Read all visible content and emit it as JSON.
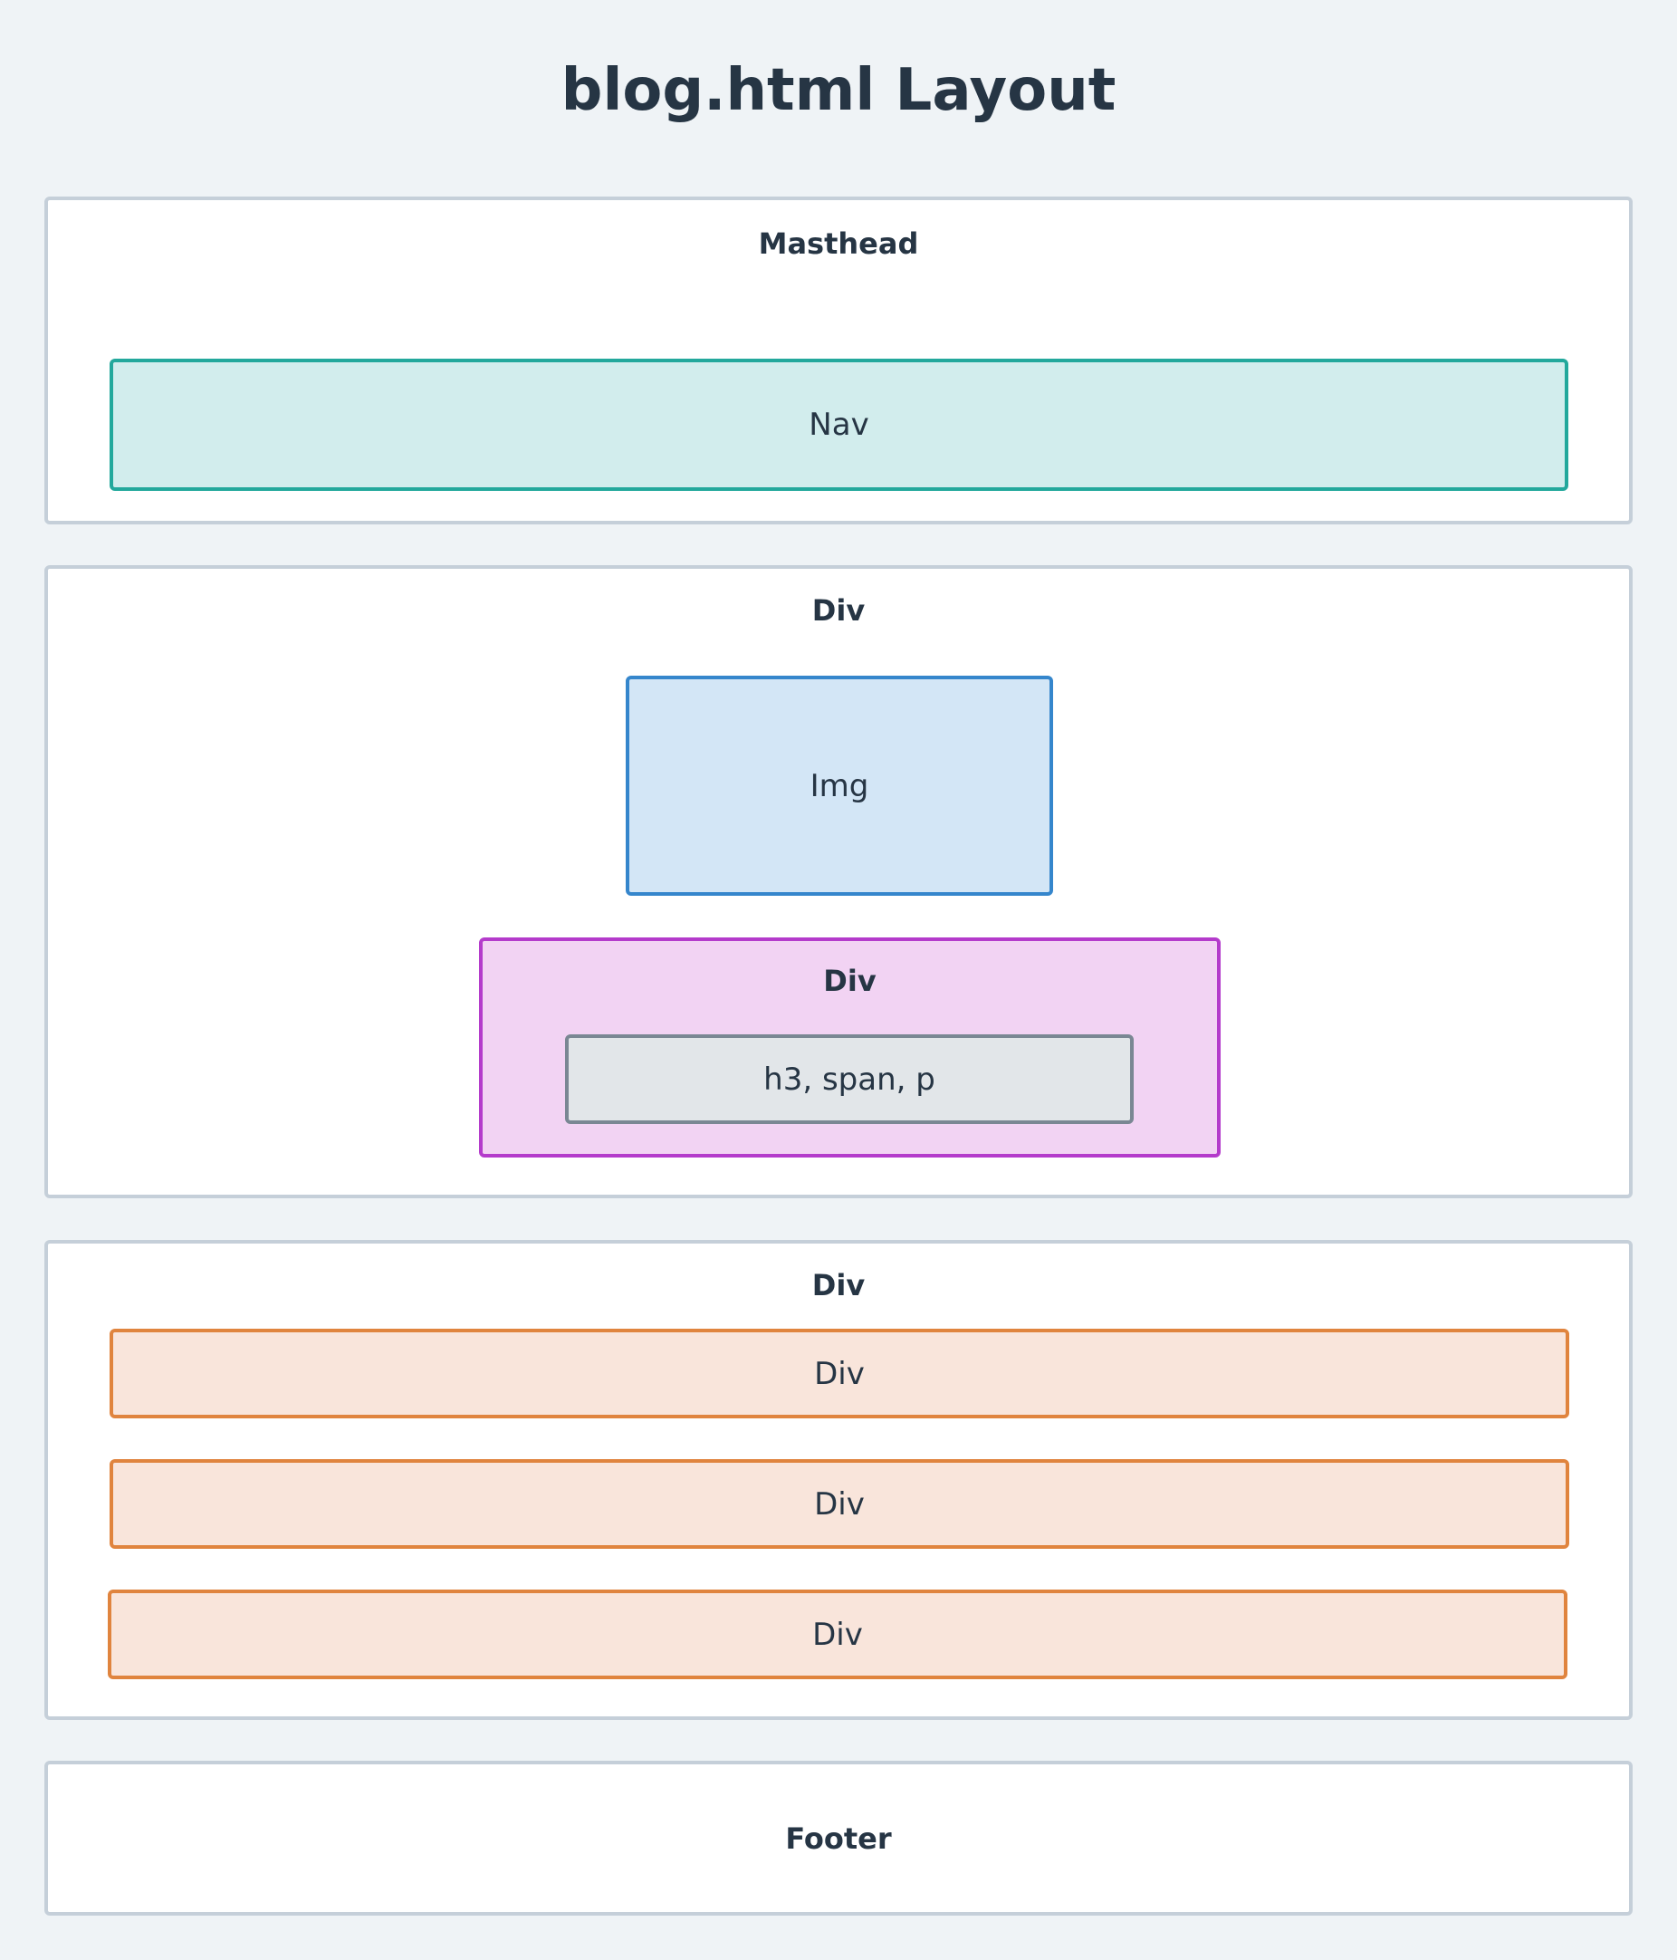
{
  "title": "blog.html Layout",
  "masthead": {
    "label": "Masthead",
    "nav": "Nav"
  },
  "hero": {
    "label": "Div",
    "img": "Img",
    "inner": {
      "label": "Div",
      "content": "h3, span, p"
    }
  },
  "posts": {
    "label": "Div",
    "items": [
      "Div",
      "Div",
      "Div"
    ]
  },
  "footer": {
    "label": "Footer"
  },
  "colors": {
    "background": "#eff3f6",
    "section_border": "#c5cfd9",
    "nav_fill": "#d2eded",
    "nav_border": "#23a89c",
    "img_fill": "#d3e6f6",
    "img_border": "#3586cc",
    "inner_div_fill": "#f2d3f3",
    "inner_div_border": "#b43bcb",
    "content_fill": "#e2e6e9",
    "content_border": "#7a8793",
    "post_fill": "#f9e5db",
    "post_border": "#e0843e",
    "text": "#263544"
  }
}
